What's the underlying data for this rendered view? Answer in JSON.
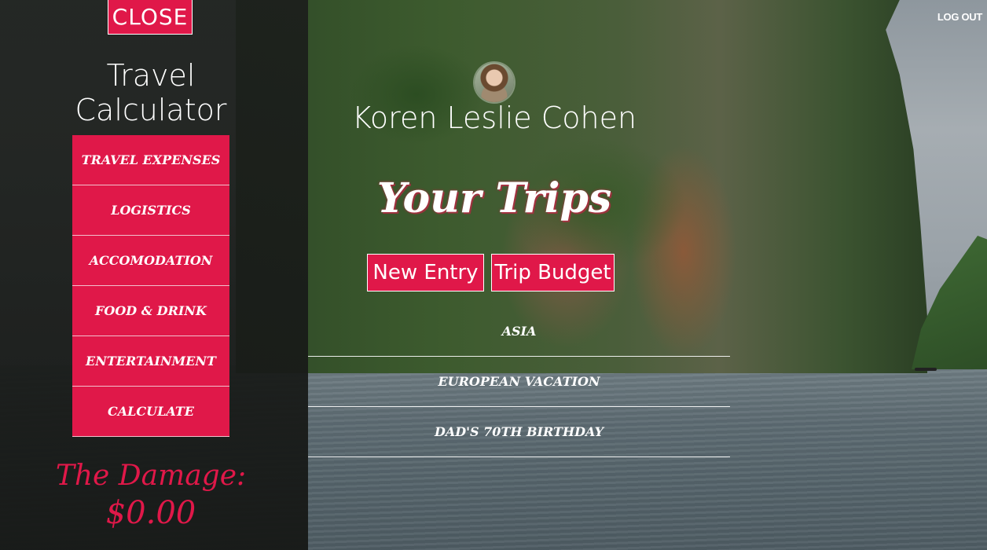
{
  "sidebar": {
    "close_label": "CLOSE",
    "app_title": "Travel Calculator",
    "nav_items": [
      {
        "label": "TRAVEL EXPENSES"
      },
      {
        "label": "LOGISTICS"
      },
      {
        "label": "ACCOMODATION"
      },
      {
        "label": "FOOD & DRINK"
      },
      {
        "label": "ENTERTAINMENT"
      },
      {
        "label": "CALCULATE"
      }
    ],
    "damage_label": "The Damage:",
    "damage_value": "$0.00"
  },
  "header": {
    "logout_label": "LOG OUT"
  },
  "main": {
    "user_name": "Koren Leslie Cohen",
    "trips_heading": "Your Trips",
    "new_entry_label": "New Entry",
    "trip_budget_label": "Trip Budget",
    "trips": [
      {
        "label": "ASIA"
      },
      {
        "label": "EUROPEAN VACATION"
      },
      {
        "label": "DAD'S 70TH BIRTHDAY"
      }
    ]
  },
  "colors": {
    "accent": "#e01849",
    "sidebar_bg": "#1c1f1c"
  }
}
